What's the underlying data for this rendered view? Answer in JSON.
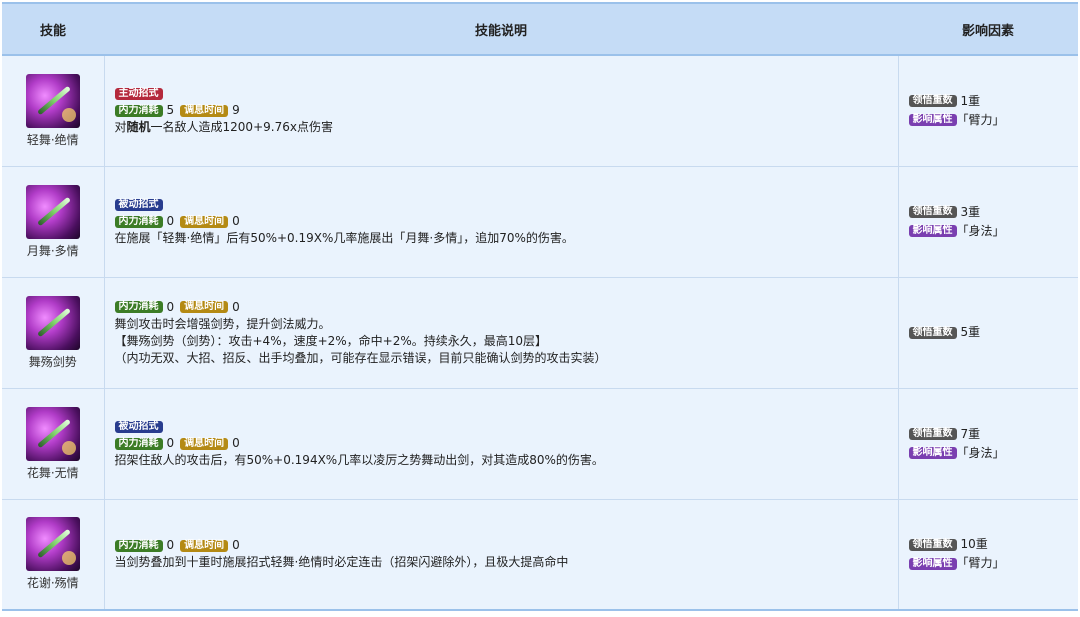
{
  "header": {
    "col_skill": "技能",
    "col_desc": "技能说明",
    "col_factor": "影响因素"
  },
  "labels": {
    "active": "主动招式",
    "passive": "被动招式",
    "neili": "内力消耗",
    "tiaoxi": "调息时间",
    "lingwu": "领悟重数",
    "yingxiang": "影响属性"
  },
  "rows": [
    {
      "name": "轻舞·绝情",
      "neili": "5",
      "tiaoxi": "9",
      "desc_pre": "对",
      "desc_kw": "随机",
      "desc_post": "一名敌人造成1200+9.76x点伤害",
      "lingwu": "1重",
      "attr": "「臂力」"
    },
    {
      "name": "月舞·多情",
      "neili": "0",
      "tiaoxi": "0",
      "desc": "在施展「轻舞·绝情」后有50%+0.19X%几率施展出「月舞·多情」，追加70%的伤害。",
      "lingwu": "3重",
      "attr": "「身法」"
    },
    {
      "name": "舞殇剑势",
      "neili": "0",
      "tiaoxi": "0",
      "desc1": "舞剑攻击时会增强剑势，提升剑法威力。",
      "desc2": "【舞殇剑势（剑势）：攻击+4%，速度+2%，命中+2%。持续永久，最高10层】",
      "desc3": "（内功无双、大招、招反、出手均叠加，可能存在显示错误，目前只能确认剑势的攻击实装）",
      "lingwu": "5重"
    },
    {
      "name": "花舞·无情",
      "neili": "0",
      "tiaoxi": "0",
      "desc": "招架住敌人的攻击后，有50%+0.194X%几率以凌厉之势舞动出剑，对其造成80%的伤害。",
      "lingwu": "7重",
      "attr": "「身法」"
    },
    {
      "name": "花谢·殇情",
      "neili": "0",
      "tiaoxi": "0",
      "desc": "当剑势叠加到十重时施展招式轻舞·绝情时必定连击（招架闪避除外），且极大提高命中",
      "lingwu": "10重",
      "attr": "「臂力」"
    }
  ]
}
